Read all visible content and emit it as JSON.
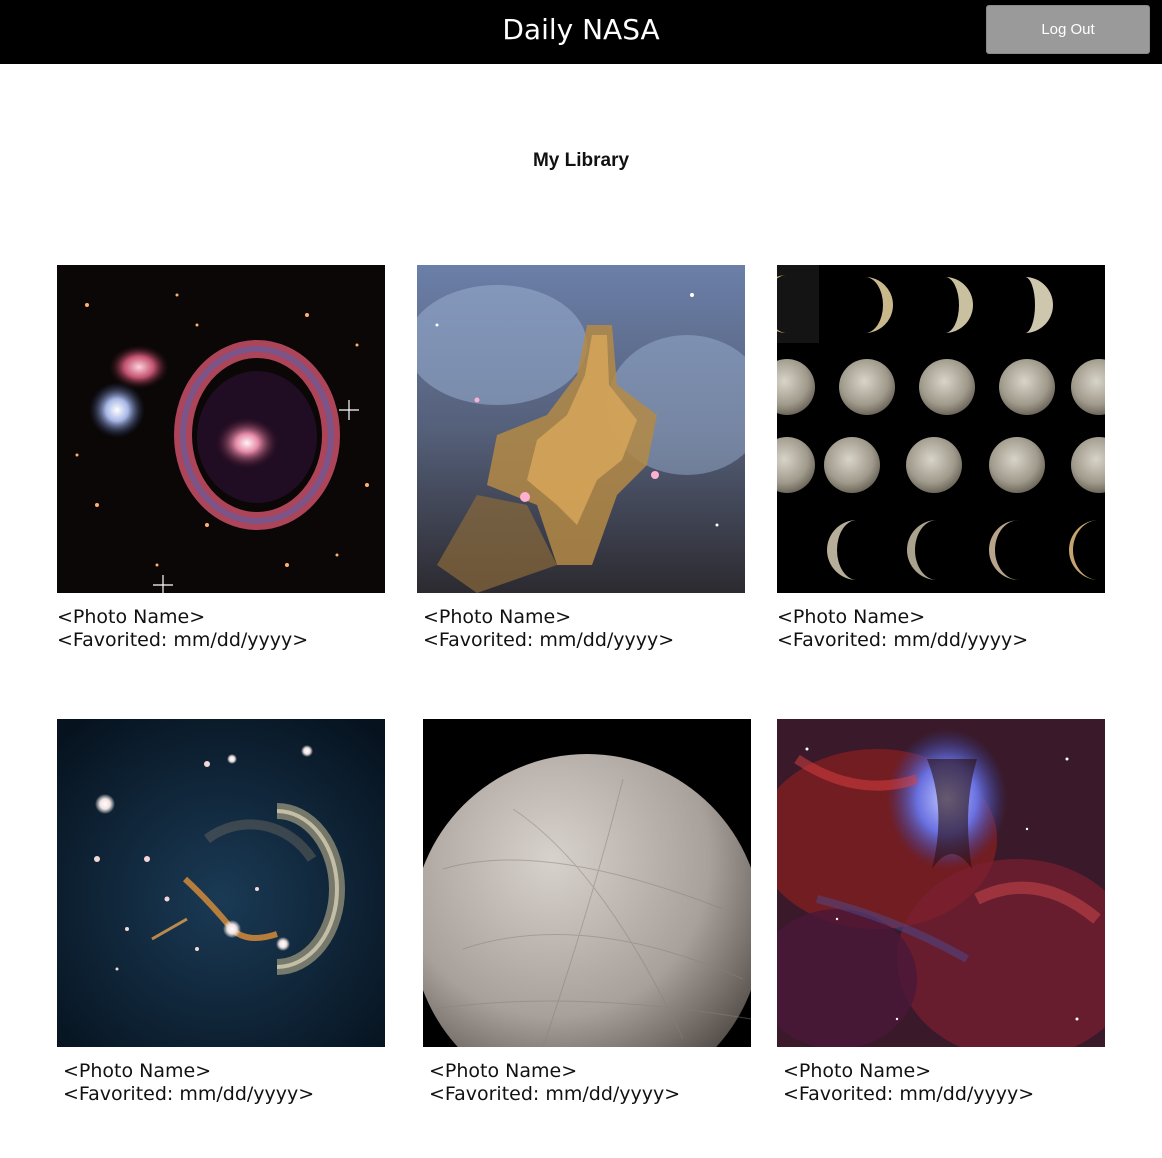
{
  "header": {
    "title": "Daily NASA",
    "logout_label": "Log Out"
  },
  "page": {
    "heading": "My Library"
  },
  "photos": [
    {
      "name": "<Photo Name>",
      "favorited": "<Favorited: mm/dd/yyyy>",
      "image": "cartwheel-galaxy"
    },
    {
      "name": "<Photo Name>",
      "favorited": "<Favorited: mm/dd/yyyy>",
      "image": "nebula-pillar"
    },
    {
      "name": "<Photo Name>",
      "favorited": "<Favorited: mm/dd/yyyy>",
      "image": "moon-phases"
    },
    {
      "name": "<Photo Name>",
      "favorited": "<Favorited: mm/dd/yyyy>",
      "image": "supernova-remnant"
    },
    {
      "name": "<Photo Name>",
      "favorited": "<Favorited: mm/dd/yyyy>",
      "image": "europa-moon"
    },
    {
      "name": "<Photo Name>",
      "favorited": "<Favorited: mm/dd/yyyy>",
      "image": "eagle-nebula"
    }
  ]
}
